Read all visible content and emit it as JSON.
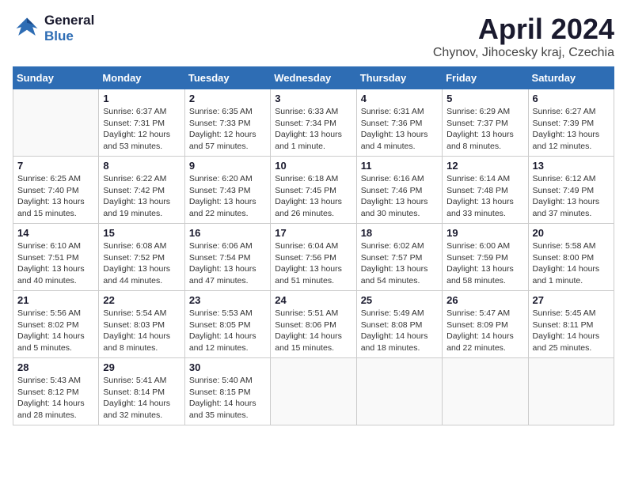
{
  "logo": {
    "line1": "General",
    "line2": "Blue"
  },
  "title": "April 2024",
  "subtitle": "Chynov, Jihocesky kraj, Czechia",
  "days_of_week": [
    "Sunday",
    "Monday",
    "Tuesday",
    "Wednesday",
    "Thursday",
    "Friday",
    "Saturday"
  ],
  "weeks": [
    [
      {
        "day": "",
        "info": ""
      },
      {
        "day": "1",
        "info": "Sunrise: 6:37 AM\nSunset: 7:31 PM\nDaylight: 12 hours\nand 53 minutes."
      },
      {
        "day": "2",
        "info": "Sunrise: 6:35 AM\nSunset: 7:33 PM\nDaylight: 12 hours\nand 57 minutes."
      },
      {
        "day": "3",
        "info": "Sunrise: 6:33 AM\nSunset: 7:34 PM\nDaylight: 13 hours\nand 1 minute."
      },
      {
        "day": "4",
        "info": "Sunrise: 6:31 AM\nSunset: 7:36 PM\nDaylight: 13 hours\nand 4 minutes."
      },
      {
        "day": "5",
        "info": "Sunrise: 6:29 AM\nSunset: 7:37 PM\nDaylight: 13 hours\nand 8 minutes."
      },
      {
        "day": "6",
        "info": "Sunrise: 6:27 AM\nSunset: 7:39 PM\nDaylight: 13 hours\nand 12 minutes."
      }
    ],
    [
      {
        "day": "7",
        "info": "Sunrise: 6:25 AM\nSunset: 7:40 PM\nDaylight: 13 hours\nand 15 minutes."
      },
      {
        "day": "8",
        "info": "Sunrise: 6:22 AM\nSunset: 7:42 PM\nDaylight: 13 hours\nand 19 minutes."
      },
      {
        "day": "9",
        "info": "Sunrise: 6:20 AM\nSunset: 7:43 PM\nDaylight: 13 hours\nand 22 minutes."
      },
      {
        "day": "10",
        "info": "Sunrise: 6:18 AM\nSunset: 7:45 PM\nDaylight: 13 hours\nand 26 minutes."
      },
      {
        "day": "11",
        "info": "Sunrise: 6:16 AM\nSunset: 7:46 PM\nDaylight: 13 hours\nand 30 minutes."
      },
      {
        "day": "12",
        "info": "Sunrise: 6:14 AM\nSunset: 7:48 PM\nDaylight: 13 hours\nand 33 minutes."
      },
      {
        "day": "13",
        "info": "Sunrise: 6:12 AM\nSunset: 7:49 PM\nDaylight: 13 hours\nand 37 minutes."
      }
    ],
    [
      {
        "day": "14",
        "info": "Sunrise: 6:10 AM\nSunset: 7:51 PM\nDaylight: 13 hours\nand 40 minutes."
      },
      {
        "day": "15",
        "info": "Sunrise: 6:08 AM\nSunset: 7:52 PM\nDaylight: 13 hours\nand 44 minutes."
      },
      {
        "day": "16",
        "info": "Sunrise: 6:06 AM\nSunset: 7:54 PM\nDaylight: 13 hours\nand 47 minutes."
      },
      {
        "day": "17",
        "info": "Sunrise: 6:04 AM\nSunset: 7:56 PM\nDaylight: 13 hours\nand 51 minutes."
      },
      {
        "day": "18",
        "info": "Sunrise: 6:02 AM\nSunset: 7:57 PM\nDaylight: 13 hours\nand 54 minutes."
      },
      {
        "day": "19",
        "info": "Sunrise: 6:00 AM\nSunset: 7:59 PM\nDaylight: 13 hours\nand 58 minutes."
      },
      {
        "day": "20",
        "info": "Sunrise: 5:58 AM\nSunset: 8:00 PM\nDaylight: 14 hours\nand 1 minute."
      }
    ],
    [
      {
        "day": "21",
        "info": "Sunrise: 5:56 AM\nSunset: 8:02 PM\nDaylight: 14 hours\nand 5 minutes."
      },
      {
        "day": "22",
        "info": "Sunrise: 5:54 AM\nSunset: 8:03 PM\nDaylight: 14 hours\nand 8 minutes."
      },
      {
        "day": "23",
        "info": "Sunrise: 5:53 AM\nSunset: 8:05 PM\nDaylight: 14 hours\nand 12 minutes."
      },
      {
        "day": "24",
        "info": "Sunrise: 5:51 AM\nSunset: 8:06 PM\nDaylight: 14 hours\nand 15 minutes."
      },
      {
        "day": "25",
        "info": "Sunrise: 5:49 AM\nSunset: 8:08 PM\nDaylight: 14 hours\nand 18 minutes."
      },
      {
        "day": "26",
        "info": "Sunrise: 5:47 AM\nSunset: 8:09 PM\nDaylight: 14 hours\nand 22 minutes."
      },
      {
        "day": "27",
        "info": "Sunrise: 5:45 AM\nSunset: 8:11 PM\nDaylight: 14 hours\nand 25 minutes."
      }
    ],
    [
      {
        "day": "28",
        "info": "Sunrise: 5:43 AM\nSunset: 8:12 PM\nDaylight: 14 hours\nand 28 minutes."
      },
      {
        "day": "29",
        "info": "Sunrise: 5:41 AM\nSunset: 8:14 PM\nDaylight: 14 hours\nand 32 minutes."
      },
      {
        "day": "30",
        "info": "Sunrise: 5:40 AM\nSunset: 8:15 PM\nDaylight: 14 hours\nand 35 minutes."
      },
      {
        "day": "",
        "info": ""
      },
      {
        "day": "",
        "info": ""
      },
      {
        "day": "",
        "info": ""
      },
      {
        "day": "",
        "info": ""
      }
    ]
  ]
}
